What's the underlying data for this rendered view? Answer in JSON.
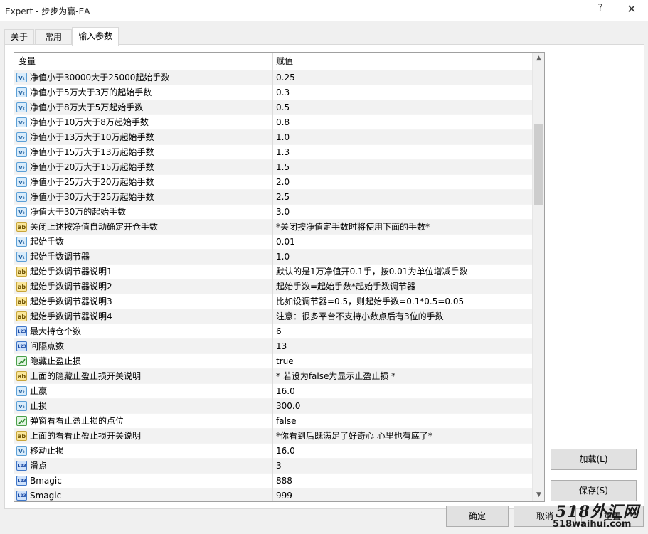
{
  "window": {
    "title": "Expert - 步步为赢-EA",
    "help_label": "?",
    "close_label": "✕"
  },
  "tabs": [
    {
      "label": "关于"
    },
    {
      "label": "常用"
    },
    {
      "label": "输入参数"
    }
  ],
  "grid": {
    "col_variable": "变量",
    "col_value": "赋值",
    "rows": [
      {
        "icon": "double-icon",
        "name": "净值小于30000大于25000起始手数",
        "value": "0.25"
      },
      {
        "icon": "double-icon",
        "name": "净值小于5万大于3万的起始手数",
        "value": "0.3"
      },
      {
        "icon": "double-icon",
        "name": "净值小于8万大于5万起始手数",
        "value": "0.5"
      },
      {
        "icon": "double-icon",
        "name": "净值小于10万大于8万起始手数",
        "value": "0.8"
      },
      {
        "icon": "double-icon",
        "name": "净值小于13万大于10万起始手数",
        "value": "1.0"
      },
      {
        "icon": "double-icon",
        "name": "净值小于15万大于13万起始手数",
        "value": "1.3"
      },
      {
        "icon": "double-icon",
        "name": "净值小于20万大于15万起始手数",
        "value": "1.5"
      },
      {
        "icon": "double-icon",
        "name": "净值小于25万大于20万起始手数",
        "value": "2.0"
      },
      {
        "icon": "double-icon",
        "name": "净值小于30万大于25万起始手数",
        "value": "2.5"
      },
      {
        "icon": "double-icon",
        "name": "净值大于30万的起始手数",
        "value": "3.0"
      },
      {
        "icon": "string-icon",
        "name": "关闭上述按净值自动确定开仓手数",
        "value": "*关闭按净值定手数时将使用下面的手数*"
      },
      {
        "icon": "double-icon",
        "name": "起始手数",
        "value": "0.01"
      },
      {
        "icon": "double-icon",
        "name": "起始手数调节器",
        "value": "1.0"
      },
      {
        "icon": "string-icon",
        "name": "起始手数调节器说明1",
        "value": "默认的是1万净值开0.1手，按0.01为单位增减手数"
      },
      {
        "icon": "string-icon",
        "name": "起始手数调节器说明2",
        "value": "起始手数=起始手数*起始手数调节器"
      },
      {
        "icon": "string-icon",
        "name": "起始手数调节器说明3",
        "value": "比如设调节器=0.5，则起始手数=0.1*0.5=0.05"
      },
      {
        "icon": "string-icon",
        "name": "起始手数调节器说明4",
        "value": "注意：很多平台不支持小数点后有3位的手数"
      },
      {
        "icon": "integer-icon",
        "name": "最大持仓个数",
        "value": "6"
      },
      {
        "icon": "integer-icon",
        "name": "间隔点数",
        "value": "13"
      },
      {
        "icon": "bool-icon",
        "name": "隐藏止盈止损",
        "value": "true"
      },
      {
        "icon": "string-icon",
        "name": "上面的隐藏止盈止损开关说明",
        "value": "* 若设为false为显示止盈止损 *"
      },
      {
        "icon": "double-icon",
        "name": "止赢",
        "value": "16.0"
      },
      {
        "icon": "double-icon",
        "name": "止损",
        "value": "300.0"
      },
      {
        "icon": "bool-icon",
        "name": "弹窗看看止盈止损的点位",
        "value": "false"
      },
      {
        "icon": "string-icon",
        "name": "上面的看看止盈止损开关说明",
        "value": "*你看到后既满足了好奇心 心里也有底了*"
      },
      {
        "icon": "double-icon",
        "name": "移动止损",
        "value": "16.0"
      },
      {
        "icon": "integer-icon",
        "name": "滑点",
        "value": "3"
      },
      {
        "icon": "integer-icon",
        "name": "Bmagic",
        "value": "888"
      },
      {
        "icon": "integer-icon",
        "name": "Smagic",
        "value": "999"
      }
    ]
  },
  "icon_text": {
    "double": "V₂",
    "string": "ab",
    "integer": "123"
  },
  "buttons": {
    "load": "加载(L)",
    "save": "保存(S)",
    "ok": "确定",
    "cancel": "取消",
    "reset": "重置"
  },
  "watermark": {
    "line1": "518外汇网",
    "line2": "518waihui.com"
  }
}
